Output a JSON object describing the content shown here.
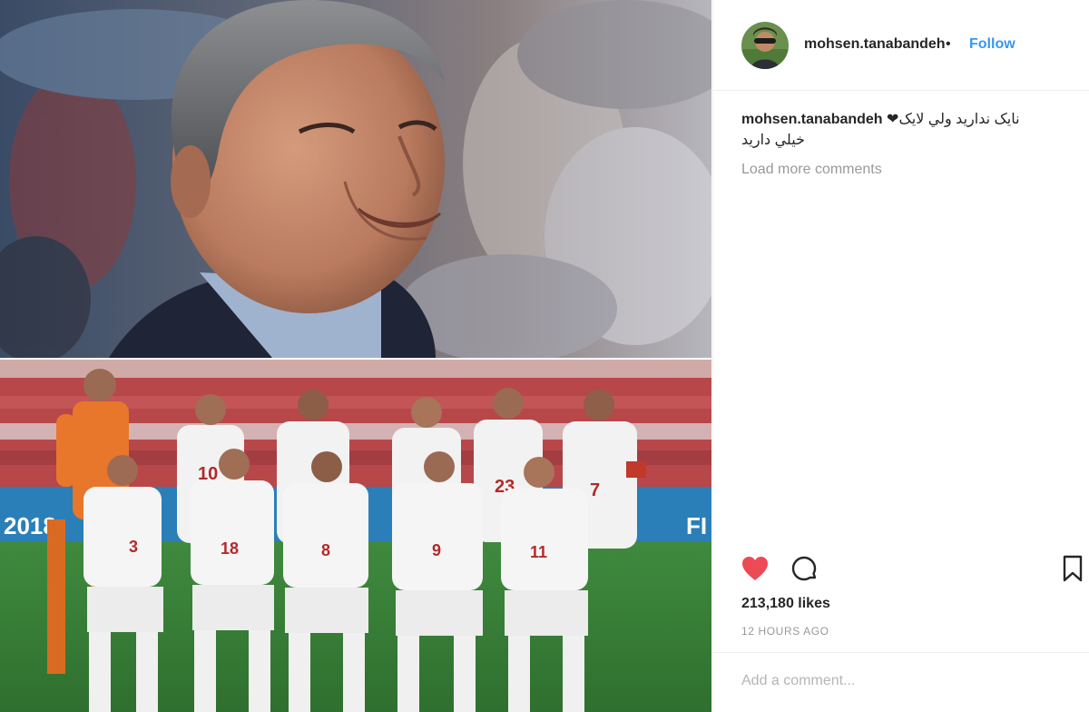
{
  "post": {
    "username": "mohsen.tanabandeh",
    "follow_separator": "•",
    "follow_label": "Follow"
  },
  "caption": {
    "username": "mohsen.tanabandeh",
    "text_line1": "نایک ندارید ولي لایک❤",
    "text_line2": "خیلي دارید"
  },
  "comments": {
    "load_more": "Load more comments"
  },
  "stats": {
    "likes": "213,180 likes",
    "time": "12 HOURS AGO"
  },
  "comment_box": {
    "placeholder": "Add a comment..."
  },
  "photo": {
    "banner_left": "2018",
    "banner_right": "FI",
    "jersey_numbers_back": [
      "10",
      "23",
      "7"
    ],
    "jersey_numbers_front": [
      "3",
      "18",
      "8",
      "9",
      "11"
    ]
  },
  "icons": {
    "heart": "heart-icon",
    "comment": "comment-icon",
    "bookmark": "bookmark-icon"
  },
  "colors": {
    "accent": "#3897f0",
    "heart": "#ed4956",
    "muted": "#999999",
    "text": "#262626"
  }
}
